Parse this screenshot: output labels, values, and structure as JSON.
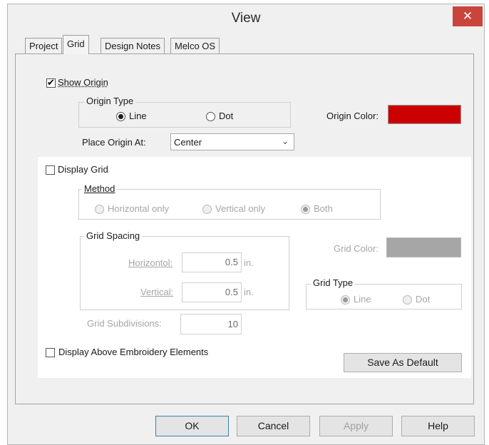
{
  "window": {
    "title": "View",
    "close_glyph": "✕"
  },
  "tabs": [
    {
      "label": "Project"
    },
    {
      "label": "Grid"
    },
    {
      "label": "Design Notes"
    },
    {
      "label": "Melco OS"
    }
  ],
  "origin": {
    "show_origin_label": "Show Origin",
    "show_origin_checked": true,
    "origin_type_legend": "Origin Type",
    "line_label": "Line",
    "dot_label": "Dot",
    "selected_type": "Line",
    "origin_color_label": "Origin Color:",
    "origin_color": "#cc0000",
    "place_origin_label": "Place Origin At:",
    "place_origin_value": "Center"
  },
  "grid": {
    "display_grid_label": "Display Grid",
    "display_grid_checked": false,
    "method_legend": "Method",
    "horizontal_only_label": "Horizontal only",
    "vertical_only_label": "Vertical only",
    "both_label": "Both",
    "selected_method": "Both",
    "spacing_legend": "Grid Spacing",
    "horizontal_label": "Horizontol:",
    "horizontal_value": "0.5",
    "vertical_label": "Vertical:",
    "vertical_value": "0.5",
    "unit": "in.",
    "subdivisions_label": "Grid Subdivisions:",
    "subdivisions_value": "10",
    "grid_color_label": "Grid Color:",
    "grid_color": "#a6a6a6",
    "grid_type_legend": "Grid Type",
    "grid_line_label": "Line",
    "grid_dot_label": "Dot",
    "selected_grid_type": "Line",
    "display_above_label": "Display Above Embroidery Elements",
    "display_above_checked": false,
    "save_default_label": "Save As Default"
  },
  "buttons": {
    "ok": "OK",
    "cancel": "Cancel",
    "apply": "Apply",
    "help": "Help"
  }
}
